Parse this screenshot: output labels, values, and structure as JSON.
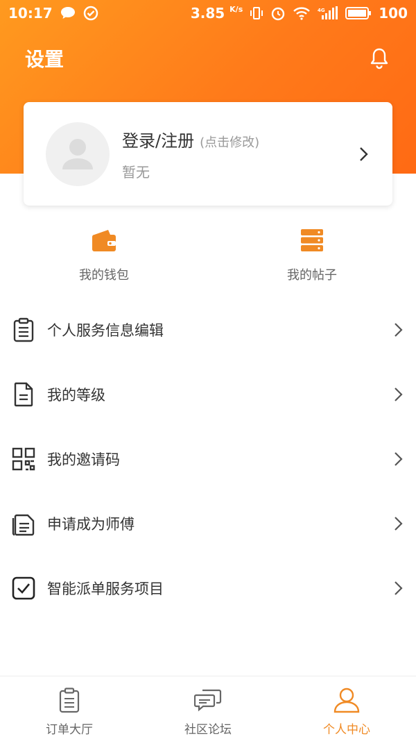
{
  "status_bar": {
    "time": "10:17",
    "speed": "3.85",
    "speed_unit": "K/s",
    "battery": "100",
    "network": "4G"
  },
  "header": {
    "title": "设置"
  },
  "profile": {
    "login_label": "登录/注册",
    "edit_hint": "(点击修改)",
    "sub_text": "暂无"
  },
  "quick_actions": [
    {
      "label": "我的钱包",
      "icon": "wallet-icon"
    },
    {
      "label": "我的帖子",
      "icon": "server-stack-icon"
    }
  ],
  "menu": [
    {
      "label": "个人服务信息编辑",
      "icon": "clipboard-icon"
    },
    {
      "label": "我的等级",
      "icon": "document-icon"
    },
    {
      "label": "我的邀请码",
      "icon": "qr-code-icon"
    },
    {
      "label": "申请成为师傅",
      "icon": "copy-documents-icon"
    },
    {
      "label": "智能派单服务项目",
      "icon": "checkbox-icon"
    }
  ],
  "tabs": [
    {
      "label": "订单大厅",
      "icon": "clipboard-icon",
      "active": false
    },
    {
      "label": "社区论坛",
      "icon": "chat-bubbles-icon",
      "active": false
    },
    {
      "label": "个人中心",
      "icon": "user-icon",
      "active": true
    }
  ],
  "colors": {
    "accent": "#f08a24",
    "header_gradient_start": "#ff9a1f",
    "header_gradient_end": "#ff6a14",
    "text_primary": "#333333",
    "text_secondary": "#999999"
  }
}
